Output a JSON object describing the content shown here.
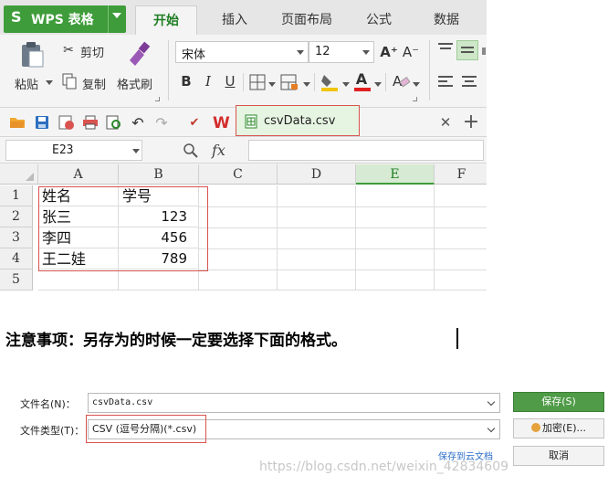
{
  "app": {
    "logo": "S",
    "name": "WPS 表格",
    "tabs": [
      "开始",
      "插入",
      "页面布局",
      "公式",
      "数据"
    ],
    "active_tab": "开始"
  },
  "ribbon": {
    "paste": "粘贴",
    "cut": "剪切",
    "copy": "复制",
    "format_painter": "格式刷",
    "font_name": "宋体",
    "font_size": "12",
    "bold": "B",
    "italic": "I",
    "underline": "U",
    "grow_font": "A⁺",
    "shrink_font": "A⁻"
  },
  "document_tab": {
    "name": "csvData.csv"
  },
  "formula_bar": {
    "cell_ref": "E23",
    "fx": "fx"
  },
  "sheet": {
    "columns": [
      "A",
      "B",
      "C",
      "D",
      "E",
      "F"
    ],
    "selected_column": "E",
    "rows": [
      "1",
      "2",
      "3",
      "4",
      "5"
    ],
    "cells": [
      [
        "姓名",
        "学号"
      ],
      [
        "张三",
        "123"
      ],
      [
        "李四",
        "456"
      ],
      [
        "王二娃",
        "789"
      ],
      [
        "",
        ""
      ]
    ]
  },
  "note": "注意事项：另存为的时候一定要选择下面的格式。",
  "dialog": {
    "filename_label": "文件名(N)：",
    "filename_value": "csvData.csv",
    "filetype_label": "文件类型(T)：",
    "filetype_value": "CSV (逗号分隔)(*.csv)",
    "save_button": "保存(S)",
    "encrypt_button": "加密(E)...",
    "save_to_cloud": "保存到云文档",
    "cancel_button": "取消"
  },
  "watermark": "https://blog.csdn.net/weixin_42834609",
  "colors": {
    "wps_green": "#3e9c3a",
    "highlight_red": "#d9534f",
    "save_green": "#4f9b47",
    "cloud_link": "#2c6ec7"
  }
}
